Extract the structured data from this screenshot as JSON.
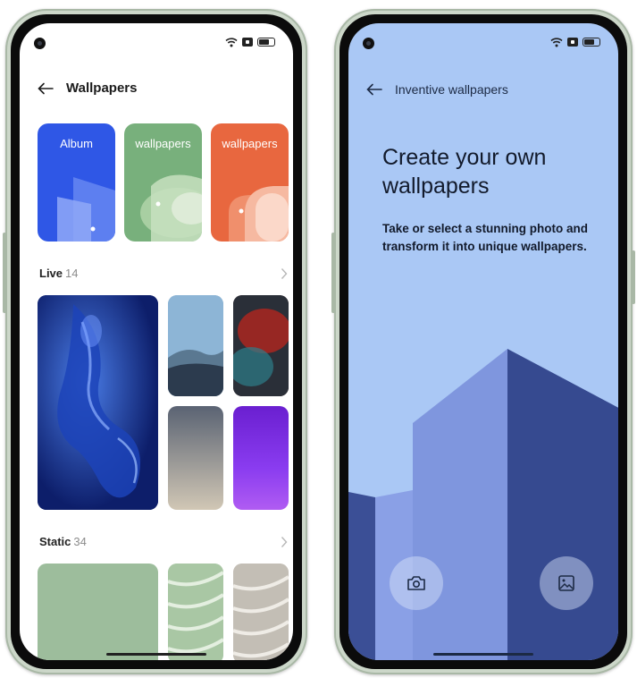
{
  "left_screen": {
    "title": "Wallpapers",
    "categories": [
      {
        "label": "Album",
        "color": "#2f57e6"
      },
      {
        "label": "wallpapers",
        "color": "#78b07c"
      },
      {
        "label": "wallpapers",
        "color": "#e8673f"
      }
    ],
    "sections": [
      {
        "name": "Live",
        "count": "14"
      },
      {
        "name": "Static",
        "count": "34"
      }
    ]
  },
  "right_screen": {
    "title": "Inventive wallpapers",
    "heading": "Create your own wallpapers",
    "description": "Take or select a stunning photo and transform it into unique wallpapers.",
    "background_color": "#aac8f5"
  },
  "icons": {
    "back": "arrow-left-icon",
    "camera": "camera-icon",
    "gallery": "image-icon",
    "chevron": "chevron-right-icon",
    "wifi": "wifi-icon",
    "battery": "battery-icon"
  }
}
